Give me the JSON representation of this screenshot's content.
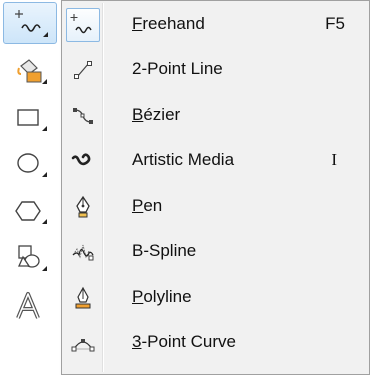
{
  "toolbox": {
    "tools": [
      {
        "name": "freehand-tool",
        "icon": "freehand-icon",
        "active": true
      },
      {
        "name": "smart-fill-tool",
        "icon": "paint-bucket-icon",
        "active": false
      },
      {
        "name": "rectangle-tool",
        "icon": "rectangle-icon",
        "active": false
      },
      {
        "name": "ellipse-tool",
        "icon": "ellipse-icon",
        "active": false
      },
      {
        "name": "polygon-tool",
        "icon": "hexagon-icon",
        "active": false
      },
      {
        "name": "basic-shapes-tool",
        "icon": "basic-shapes-icon",
        "active": false
      },
      {
        "name": "text-tool",
        "icon": "text-a-icon",
        "active": false
      }
    ]
  },
  "flyout": {
    "items": [
      {
        "label_u": "F",
        "label_rest": "reehand",
        "shortcut": "F5",
        "icon": "freehand-icon"
      },
      {
        "label_u": "",
        "label_rest": "2-Point Line",
        "shortcut": "",
        "icon": "two-point-line-icon"
      },
      {
        "label_u": "B",
        "label_rest": "ézier",
        "shortcut": "",
        "icon": "bezier-icon"
      },
      {
        "label_u": "",
        "label_rest": "Artistic Media",
        "shortcut": "I",
        "icon": "artistic-media-icon"
      },
      {
        "label_u": "P",
        "label_rest": "en",
        "shortcut": "",
        "icon": "pen-icon"
      },
      {
        "label_u": "",
        "label_rest": "B-Spline",
        "shortcut": "",
        "icon": "b-spline-icon"
      },
      {
        "label_u": "P",
        "label_rest": "olyline",
        "shortcut": "",
        "icon": "polyline-icon"
      },
      {
        "label_u": "3",
        "label_rest": "-Point Curve",
        "shortcut": "",
        "icon": "three-point-curve-icon"
      }
    ]
  },
  "colors": {
    "accent_border": "#8cb9e3",
    "menu_bg": "#f1f1f1",
    "icon_orange": "#f0a030"
  }
}
